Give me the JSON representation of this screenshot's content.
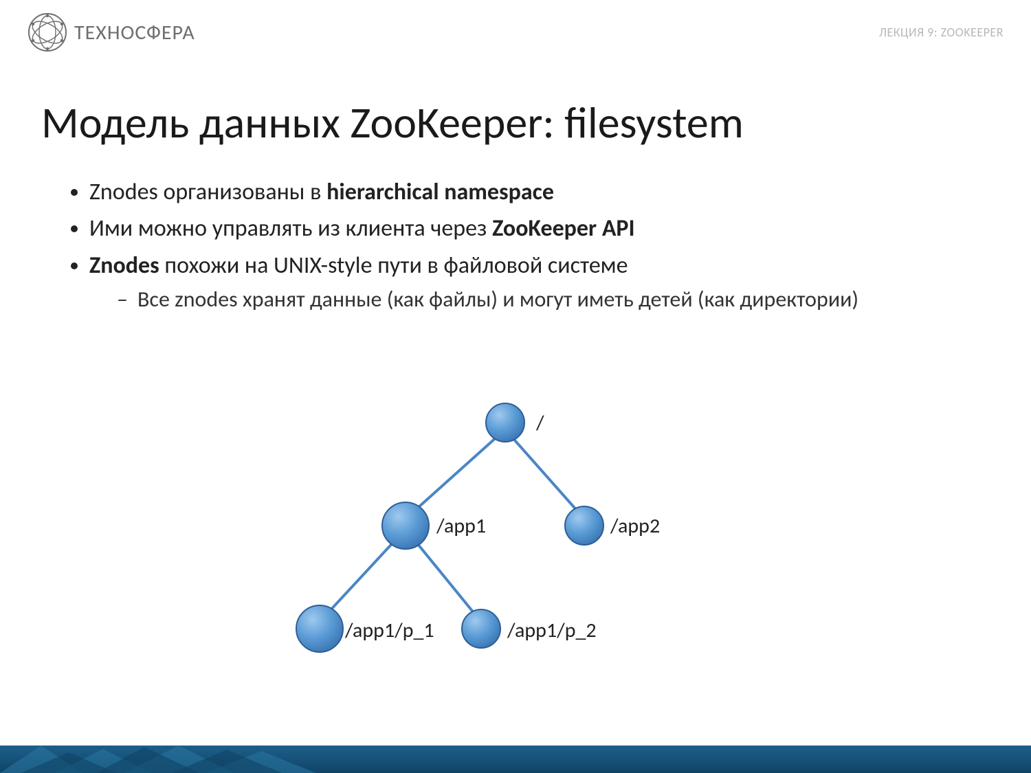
{
  "header": {
    "brand": "ТЕХНОСФЕРА",
    "lecture": "ЛЕКЦИЯ 9: ZOOKEEPER"
  },
  "title": "Модель данных ZooKeeper: filesystem",
  "bullets": {
    "b1_a": "Znodes организованы в ",
    "b1_b": "hierarchical namespace",
    "b2_a": "Ими можно управлять из клиента через ",
    "b2_b": "ZooKeeper API",
    "b3_a": "Znodes",
    "b3_b": " похожи на UNIX-style пути в файловой системе",
    "b3_sub": "Все znodes хранят данные (как файлы) и могут иметь детей (как директории)"
  },
  "diagram": {
    "root": "/",
    "app1": "/app1",
    "app2": "/app2",
    "p1": "/app1/p_1",
    "p2": "/app1/p_2"
  },
  "chart_data": {
    "type": "tree",
    "nodes": [
      {
        "id": "root",
        "label": "/",
        "parent": null
      },
      {
        "id": "app1",
        "label": "/app1",
        "parent": "root"
      },
      {
        "id": "app2",
        "label": "/app2",
        "parent": "root"
      },
      {
        "id": "p1",
        "label": "/app1/p_1",
        "parent": "app1"
      },
      {
        "id": "p2",
        "label": "/app1/p_2",
        "parent": "app1"
      }
    ]
  }
}
